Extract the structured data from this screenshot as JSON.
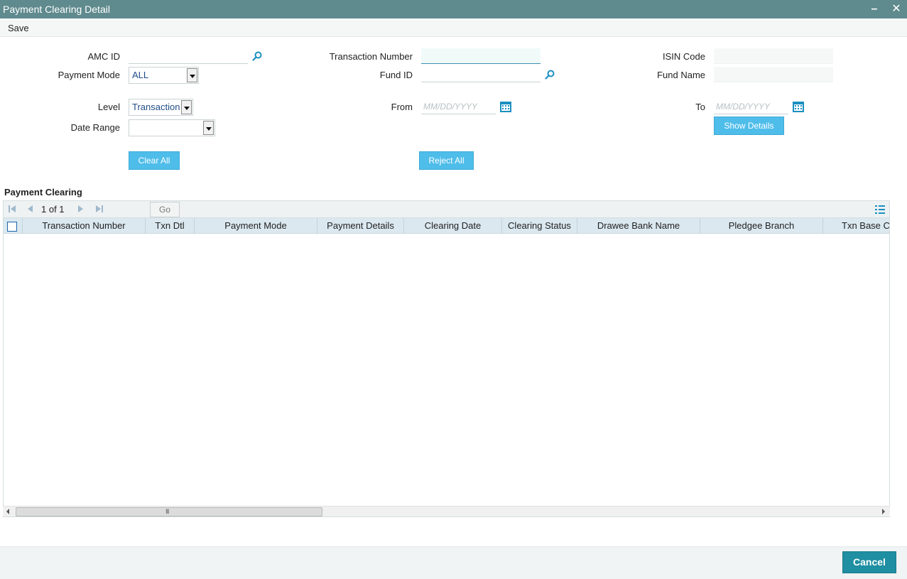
{
  "window": {
    "title": "Payment Clearing Detail",
    "minimize": "–",
    "close": "✕"
  },
  "menu": {
    "save": "Save"
  },
  "form": {
    "amc_id_label": "AMC ID",
    "amc_id_value": "",
    "payment_mode_label": "Payment Mode",
    "payment_mode_value": "ALL",
    "level_label": "Level",
    "level_value": "Transaction",
    "date_range_label": "Date Range",
    "date_range_value": "",
    "transaction_number_label": "Transaction Number",
    "transaction_number_value": "",
    "fund_id_label": "Fund ID",
    "fund_id_value": "",
    "from_label": "From",
    "from_placeholder": "MM/DD/YYYY",
    "isin_code_label": "ISIN Code",
    "isin_code_value": "",
    "fund_name_label": "Fund Name",
    "fund_name_value": "",
    "to_label": "To",
    "to_placeholder": "MM/DD/YYYY",
    "show_details": "Show Details",
    "clear_all": "Clear All",
    "reject_all": "Reject All"
  },
  "grid": {
    "section_title": "Payment Clearing",
    "pager_text": "1 of 1",
    "go": "Go",
    "columns": [
      "Transaction Number",
      "Txn Dtl",
      "Payment Mode",
      "Payment Details",
      "Clearing Date",
      "Clearing Status",
      "Drawee Bank Name",
      "Pledgee Branch",
      "Txn Base C"
    ],
    "scroll_grip": "III"
  },
  "footer": {
    "cancel": "Cancel"
  },
  "colors": {
    "titlebar": "#5f8a8e",
    "accent_button": "#4fbdea",
    "cancel_button": "#1f8fa2",
    "grid_header": "#dbe8f0",
    "icon_blue": "#1a8fc0"
  }
}
